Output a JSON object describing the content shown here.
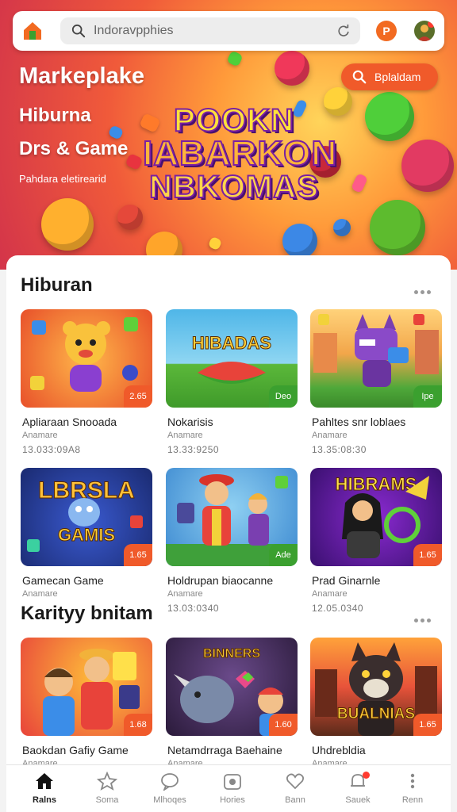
{
  "header": {
    "search_placeholder": "Indoravpphies",
    "profile_initial": "P"
  },
  "hero": {
    "title": "Markeplake",
    "subtitle1": "Hiburna",
    "subtitle2": "Drs & Game",
    "tagline": "Pahdara eletirearid",
    "button_label": "Bplaldam",
    "logo_lines": [
      "POOKN",
      "IABARKON",
      "NBKOMAS"
    ]
  },
  "sections": [
    {
      "title": "Hiburan",
      "cards": [
        {
          "title": "Apliaraan Snooada",
          "category": "Anamare",
          "meta": "13.033:09A8",
          "badge": "2.65",
          "badge_color": "#f05a2a"
        },
        {
          "title": "Nokarisis",
          "category": "Anamare",
          "meta": "13.33:9250",
          "badge": "Deo",
          "badge_color": "#3ba02f"
        },
        {
          "title": "Pahltes snr loblaes",
          "category": "Anamare",
          "meta": "13.35:08:30",
          "badge": "Ipe",
          "badge_color": "#3ba02f"
        },
        {
          "title": "Gamecan Game",
          "category": "Anamare",
          "meta": "",
          "badge": "1.65",
          "badge_color": "#f05a2a"
        },
        {
          "title": "Holdrupan biaocanne",
          "category": "Anamare",
          "meta": "13.03:0340",
          "badge": "Ade",
          "badge_color": "#3ba02f"
        },
        {
          "title": "Prad Ginarnle",
          "category": "Anamare",
          "meta": "12.05.0340",
          "badge": "1.65",
          "badge_color": "#f05a2a"
        }
      ]
    },
    {
      "title": "Karityy bnitam",
      "cards": [
        {
          "title": "Baokdan Gafiy Game",
          "category": "Anamare",
          "badge": "1.68",
          "badge_color": "#f05a2a"
        },
        {
          "title": "Netamdrraga Baehaine",
          "category": "Anamare",
          "badge": "1.60",
          "badge_color": "#f05a2a"
        },
        {
          "title": "Uhdrebldia",
          "category": "Anamare",
          "badge": "1.65",
          "badge_color": "#f05a2a"
        }
      ]
    }
  ],
  "thumb_text": {
    "hibadas": "HIBADAS",
    "lbrsla": "LBRSLA",
    "gamis": "GAMIS",
    "hibrams": "HIBRAMS",
    "binners": "BINNERS",
    "bualnias": "BUALNIAS"
  },
  "nav": [
    {
      "label": "Ralns",
      "icon": "home-icon",
      "active": true
    },
    {
      "label": "Soma",
      "icon": "star-icon"
    },
    {
      "label": "Mlhoqes",
      "icon": "chat-icon"
    },
    {
      "label": "Hories",
      "icon": "calendar-icon"
    },
    {
      "label": "Bann",
      "icon": "heart-icon"
    },
    {
      "label": "Sauek",
      "icon": "bell-icon"
    },
    {
      "label": "Renn",
      "icon": "more-vert-icon"
    }
  ],
  "colors": {
    "accent": "#f05a2a",
    "green_badge": "#3ba02f"
  }
}
